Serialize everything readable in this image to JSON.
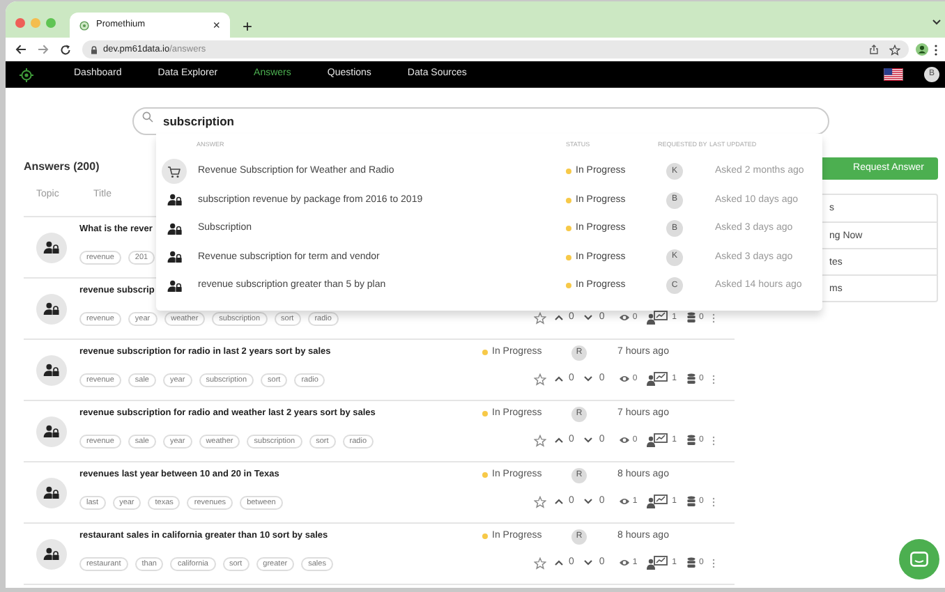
{
  "browser": {
    "tab_title": "Promethium",
    "tab_close": "×",
    "new_tab": "+",
    "url_host": "dev.pm61data.io",
    "url_path": "/answers"
  },
  "nav": {
    "items": [
      {
        "label": "Dashboard",
        "selected": false
      },
      {
        "label": "Data Explorer",
        "selected": false
      },
      {
        "label": "Answers",
        "selected": true
      },
      {
        "label": "Questions",
        "selected": false
      },
      {
        "label": "Data Sources",
        "selected": false
      }
    ],
    "avatar": "B"
  },
  "search": {
    "value": "subscription"
  },
  "suggestions": {
    "columns": [
      "ANSWER",
      "STATUS",
      "REQUESTED BY",
      "LAST UPDATED"
    ],
    "rows": [
      {
        "kind": "cart",
        "title": "Revenue Subscription for Weather and Radio",
        "status": "In Progress",
        "requester": "K",
        "updated": "Asked 2 months ago"
      },
      {
        "kind": "person",
        "title": "subscription revenue by package from 2016 to 2019",
        "status": "In Progress",
        "requester": "B",
        "updated": "Asked 10 days ago"
      },
      {
        "kind": "person",
        "title": "Subscription",
        "status": "In Progress",
        "requester": "B",
        "updated": "Asked 3 days ago"
      },
      {
        "kind": "person",
        "title": "Revenue subscription for term and vendor",
        "status": "In Progress",
        "requester": "K",
        "updated": "Asked 3 days ago"
      },
      {
        "kind": "person",
        "title": "revenue subscription greater than 5 by plan",
        "status": "In Progress",
        "requester": "C",
        "updated": "Asked 14 hours ago"
      }
    ]
  },
  "answers": {
    "title": "Answers (200)",
    "columns": [
      "Topic",
      "Title"
    ],
    "rows": [
      {
        "title": "What is the rever",
        "tags": [
          "revenue",
          "201"
        ]
      },
      {
        "title": "revenue subscrip",
        "tags": [
          "revenue",
          "year",
          "weather",
          "subscription",
          "sort",
          "radio"
        ],
        "up": "0",
        "down": "0",
        "views": "0",
        "charts": "1",
        "data": "0"
      },
      {
        "title": "revenue subscription for radio in last 2 years sort by sales",
        "tags": [
          "revenue",
          "sale",
          "year",
          "subscription",
          "sort",
          "radio"
        ],
        "status": "In Progress",
        "requester": "R",
        "time": "7 hours ago",
        "up": "0",
        "down": "0",
        "views": "0",
        "charts": "1",
        "data": "0"
      },
      {
        "title": "revenue subscription for radio and weather last 2 years sort by sales",
        "tags": [
          "revenue",
          "sale",
          "year",
          "weather",
          "subscription",
          "sort",
          "radio"
        ],
        "status": "In Progress",
        "requester": "R",
        "time": "7 hours ago",
        "up": "0",
        "down": "0",
        "views": "0",
        "charts": "1",
        "data": "0"
      },
      {
        "title": "revenues last year between 10 and 20 in Texas",
        "tags": [
          "last",
          "year",
          "texas",
          "revenues",
          "between"
        ],
        "status": "In Progress",
        "requester": "R",
        "time": "8 hours ago",
        "up": "0",
        "down": "0",
        "views": "1",
        "charts": "1",
        "data": "0"
      },
      {
        "title": "restaurant sales in california greater than 10 sort by sales",
        "tags": [
          "restaurant",
          "than",
          "california",
          "sort",
          "greater",
          "sales"
        ],
        "status": "In Progress",
        "requester": "R",
        "time": "8 hours ago",
        "up": "0",
        "down": "0",
        "views": "1",
        "charts": "1",
        "data": "0"
      }
    ]
  },
  "sidebar": {
    "button": "Request Answer",
    "items": [
      "s",
      "ng Now",
      "tes",
      "ms"
    ]
  }
}
